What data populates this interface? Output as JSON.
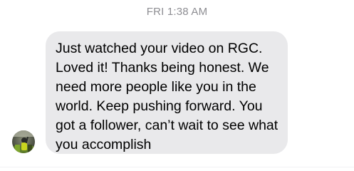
{
  "thread": {
    "timestamp": "FRI 1:38 AM",
    "message": {
      "lines": [
        "Just watched your video on RGC.",
        "Loved it! Thanks being honest. We",
        "need more people like you in the",
        "world. Keep pushing forward. You",
        "got a follower, can’t wait to see what",
        "you accomplish"
      ]
    },
    "sender": {
      "avatar_icon": "contact-photo"
    }
  },
  "colors": {
    "bubble_background": "#e9e9eb",
    "timestamp_text": "#8e8e93",
    "message_text": "#000000"
  }
}
